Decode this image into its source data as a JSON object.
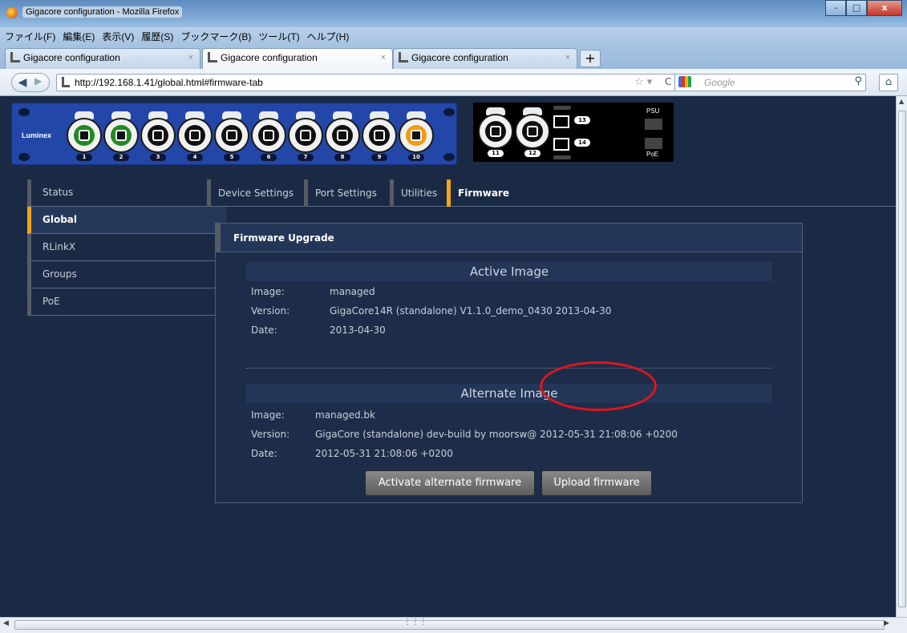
{
  "window": {
    "title": "Gigacore configuration - Mozilla Firefox",
    "controls": {
      "minimize": "–",
      "maximize": "□",
      "close": "x"
    }
  },
  "menu": [
    "ファイル(F)",
    "編集(E)",
    "表示(V)",
    "履歴(S)",
    "ブックマーク(B)",
    "ツール(T)",
    "ヘルプ(H)"
  ],
  "browser_tabs": [
    {
      "label": "Gigacore configuration",
      "active": false
    },
    {
      "label": "Gigacore configuration",
      "active": true
    },
    {
      "label": "Gigacore configuration",
      "active": false
    }
  ],
  "new_tab_label": "+",
  "nav": {
    "url": "http://192.168.1.41/global.html#firmware-tab",
    "search_placeholder": "Google"
  },
  "device": {
    "brand": "Luminex",
    "ports": [
      {
        "num": "1",
        "state": "green"
      },
      {
        "num": "2",
        "state": "green"
      },
      {
        "num": "3",
        "state": "off"
      },
      {
        "num": "4",
        "state": "off"
      },
      {
        "num": "5",
        "state": "off"
      },
      {
        "num": "6",
        "state": "off"
      },
      {
        "num": "7",
        "state": "off"
      },
      {
        "num": "8",
        "state": "off"
      },
      {
        "num": "9",
        "state": "off"
      },
      {
        "num": "10",
        "state": "orange"
      }
    ],
    "extra_ports": [
      "11",
      "12"
    ],
    "sfp_ports": [
      "13",
      "14"
    ],
    "psu_label": "PSU",
    "poe_label": "PoE"
  },
  "sidebar": {
    "items": [
      {
        "label": "Status",
        "active": false
      },
      {
        "label": "Global",
        "active": true
      },
      {
        "label": "RLinkX",
        "active": false
      },
      {
        "label": "Groups",
        "active": false
      },
      {
        "label": "PoE",
        "active": false
      }
    ]
  },
  "page_tabs": [
    {
      "label": "Device Settings",
      "active": false
    },
    {
      "label": "Port Settings",
      "active": false
    },
    {
      "label": "Utilities",
      "active": false
    },
    {
      "label": "Firmware",
      "active": true
    }
  ],
  "firmware": {
    "panel_title": "Firmware Upgrade",
    "active_image": {
      "heading": "Active Image",
      "image_label": "Image:",
      "image": "managed",
      "version_label": "Version:",
      "version": "GigaCore14R (standalone) V1.1.0_demo_0430 2013-04-30",
      "date_label": "Date:",
      "date": "2013-04-30"
    },
    "alternate_image": {
      "heading": "Alternate Image",
      "image_label": "Image:",
      "image": "managed.bk",
      "version_label": "Version:",
      "version": "GigaCore (standalone) dev-build by moorsw@ 2012-05-31 21:08:06 +0200",
      "date_label": "Date:",
      "date": "2012-05-31 21:08:06 +0200"
    },
    "activate_button": "Activate alternate firmware",
    "upload_button": "Upload firmware"
  },
  "colors": {
    "background": "#1b2a44",
    "accent": "#f3a516",
    "annotation": "#e0141c"
  }
}
